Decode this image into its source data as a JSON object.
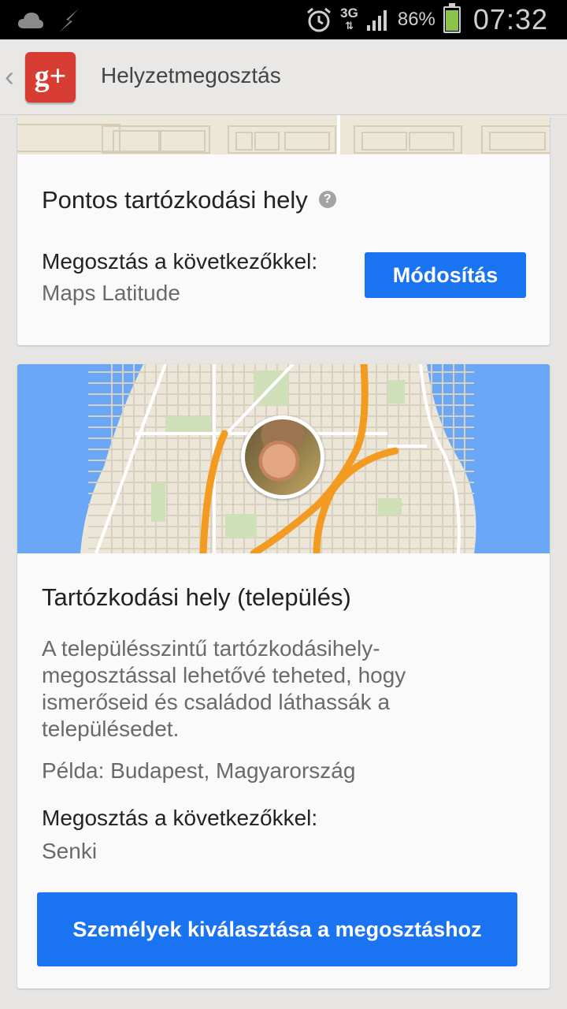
{
  "status_bar": {
    "network": "3G",
    "battery_percent": "86%",
    "battery_level": 0.86,
    "time": "07:32",
    "icons": [
      "cloud-icon",
      "usb-lightning-icon",
      "alarm-clock-icon",
      "signal-bars-icon",
      "battery-icon"
    ]
  },
  "app_bar": {
    "logo_text": "g+",
    "title": "Helyzetmegosztás"
  },
  "precise_location": {
    "title": "Pontos tartózkodási hely",
    "share_label": "Megosztás a következőkkel:",
    "share_value": "Maps Latitude",
    "modify_button": "Módosítás"
  },
  "city_location": {
    "title": "Tartózkodási hely (település)",
    "description": "A településszintű tartózkodásihely-megosztással lehetővé teheted, hogy ismerőseid és családod láthassák a településedet.",
    "example": "Példa: Budapest, Magyarország",
    "share_label": "Megosztás a következőkkel:",
    "share_value": "Senki",
    "choose_button": "Személyek kiválasztása a megosztáshoz"
  },
  "colors": {
    "accent_button": "#1a73f0",
    "map_water": "#6aa8f7",
    "map_land": "#ece6d8",
    "map_road": "#f29b20",
    "gplus_red": "#d73d32"
  }
}
